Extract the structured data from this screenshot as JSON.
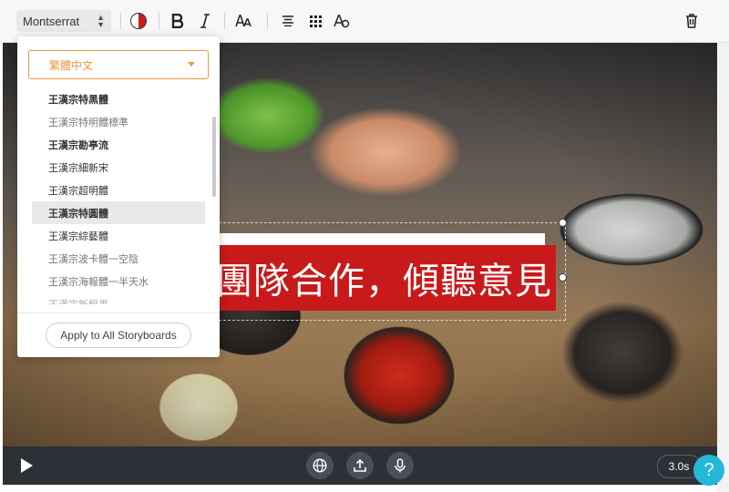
{
  "toolbar": {
    "font_family": "Montserrat",
    "text_color": "#c81e1e",
    "tools": [
      "bold-icon",
      "italic-icon",
      "font-size-icon",
      "align-center-icon",
      "grid-icon",
      "text-effect-icon",
      "trash-icon"
    ]
  },
  "font_panel": {
    "language": "繁體中文",
    "fonts": [
      {
        "label": "王漢宗特黑體",
        "selected": false
      },
      {
        "label": "王漢宗特明體標準",
        "selected": false
      },
      {
        "label": "王漢宗勘亭流",
        "selected": false
      },
      {
        "label": "王漢宗細新宋",
        "selected": false
      },
      {
        "label": "王漢宗超明體",
        "selected": false
      },
      {
        "label": "王漢宗特圓體",
        "selected": true
      },
      {
        "label": "王漢宗綜藝體",
        "selected": false
      },
      {
        "label": "王漢宗波卡體一空陰",
        "selected": false
      },
      {
        "label": "王漢宗海報體一半天水",
        "selected": false
      },
      {
        "label": "王漢宗新粗黑",
        "selected": false
      }
    ],
    "apply_label": "Apply to All Storyboards"
  },
  "canvas": {
    "caption_text": "團隊合作，傾聽意見",
    "caption_bg": "#c81a1a"
  },
  "playback": {
    "duration": "3.0s",
    "controls": [
      "globe-icon",
      "upload-icon",
      "microphone-icon"
    ]
  },
  "help": {
    "label": "?",
    "color": "#23b8d9"
  }
}
